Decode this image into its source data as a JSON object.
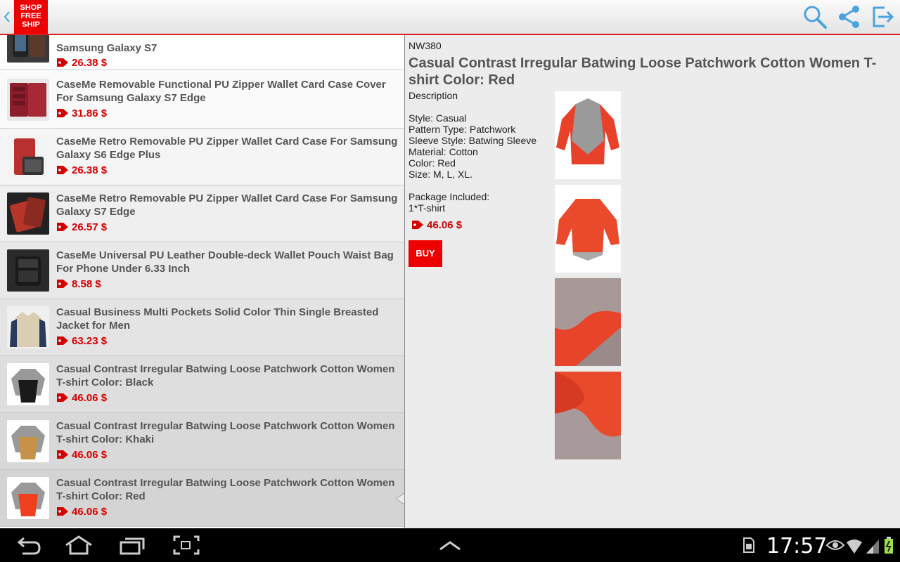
{
  "actionbar": {
    "logo_lines": [
      "SHOP",
      "FREE",
      "SHIP"
    ],
    "icons": [
      "back-icon",
      "search-icon",
      "share-icon",
      "exit-icon"
    ]
  },
  "list": {
    "items": [
      {
        "title": "Samsung Galaxy S7",
        "price": "26.38 $"
      },
      {
        "title": "CaseMe Removable Functional PU Zipper Wallet Card Case Cover For Samsung Galaxy S7 Edge",
        "price": "31.86 $"
      },
      {
        "title": "CaseMe Retro Removable PU Zipper Wallet Card Case For Samsung Galaxy S6 Edge Plus",
        "price": "26.38 $"
      },
      {
        "title": "CaseMe Retro Removable PU Zipper Wallet Card Case For Samsung Galaxy S7 Edge",
        "price": "26.57 $"
      },
      {
        "title": "CaseMe Universal PU Leather Double-deck Wallet Pouch Waist Bag For Phone Under 6.33 Inch",
        "price": "8.58 $"
      },
      {
        "title": "Casual Business Multi Pockets Solid Color Thin Single Breasted Jacket for Men",
        "price": "63.23 $"
      },
      {
        "title": "Casual Contrast Irregular Batwing Loose Patchwork Cotton Women T-shirt  Color: Black",
        "price": "46.06 $"
      },
      {
        "title": "Casual Contrast Irregular Batwing Loose Patchwork Cotton Women T-shirt Color: Khaki",
        "price": "46.06 $"
      },
      {
        "title": "Casual Contrast Irregular Batwing Loose Patchwork Cotton Women T-shirt Color: Red",
        "price": "46.06 $"
      }
    ]
  },
  "detail": {
    "sku": "NW380",
    "title": "Casual Contrast Irregular Batwing Loose Patchwork Cotton Women T-shirt Color: Red",
    "description_header": "Description",
    "spec_lines": [
      "Style: Casual",
      "Pattern Type: Patchwork",
      "Sleeve Style: Batwing Sleeve",
      "Material: Cotton",
      "Color: Red",
      "Size: M, L, XL."
    ],
    "package_header": "Package Included:",
    "package_line": "1*T-shirt",
    "price": "46.06 $",
    "buy_label": "BUY"
  },
  "statusbar": {
    "time": "17:57"
  },
  "colors": {
    "accent_red": "#e00000",
    "price_red": "#d40000",
    "title_gray": "#555555",
    "icon_blue": "#4aa3df"
  }
}
